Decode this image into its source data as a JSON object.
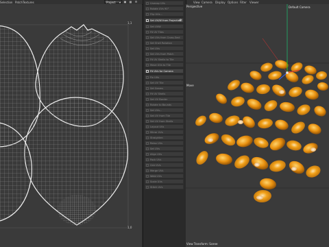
{
  "topbar": {
    "menus": [
      "Selection",
      "Patch",
      "Textures"
    ],
    "project_select": "Project",
    "viewer_menus": [
      "View",
      "Camera",
      "Display",
      "Options",
      "Filter",
      "Viewer"
    ]
  },
  "uv_viewer": {
    "corner_top_right": "1,1",
    "corner_bottom_right": "1,0"
  },
  "side_panel": {
    "items": [
      "Unwrap UVs",
      "Rotate UVs 90°",
      "Flip UVs...",
      "Set UV/W from Projection",
      "Set UVW",
      "Fit UV Tiles",
      "Set UVs from Cross-Sect",
      "Set Shell Rotation",
      "Set UVs",
      "Set UVs from Patch",
      "Fit UV Shells to Tile",
      "Move UVs to Tile",
      "Fit UVs for Camera",
      "Fix UVs",
      "Set UV Tile",
      "Set Seams",
      "Fit UV Shells",
      "Set UV Border",
      "Rotate to Bounds",
      "Set UVs...",
      "Set UV from Tile",
      "Set UV from Shells",
      "Layout UVs",
      "Mirror UVs",
      "Straighten",
      "Relax UVs",
      "Set UVs",
      "Align UVs",
      "Pack UVs",
      "Grid UVs",
      "Merge UVs",
      "Weld UVs",
      "Scale UVs",
      "Stitch UVs"
    ],
    "highlighted": [
      "Set UV/W from Projection",
      "Fit UVs for Camera"
    ]
  },
  "viewport": {
    "perspective_label": "Perspective",
    "camera_label": "Default Camera",
    "tool_label": "Move",
    "status_label": "View Transform: Scene"
  },
  "icons": {
    "gear": "gear-icon"
  },
  "colors": {
    "uv_background": "#3a3a3a",
    "uv_wire": "#9a9a9a",
    "uv_border": "#f0f0f0",
    "kernel_yellow": "#f2a21a",
    "kernel_tip": "#fbe3b0"
  }
}
